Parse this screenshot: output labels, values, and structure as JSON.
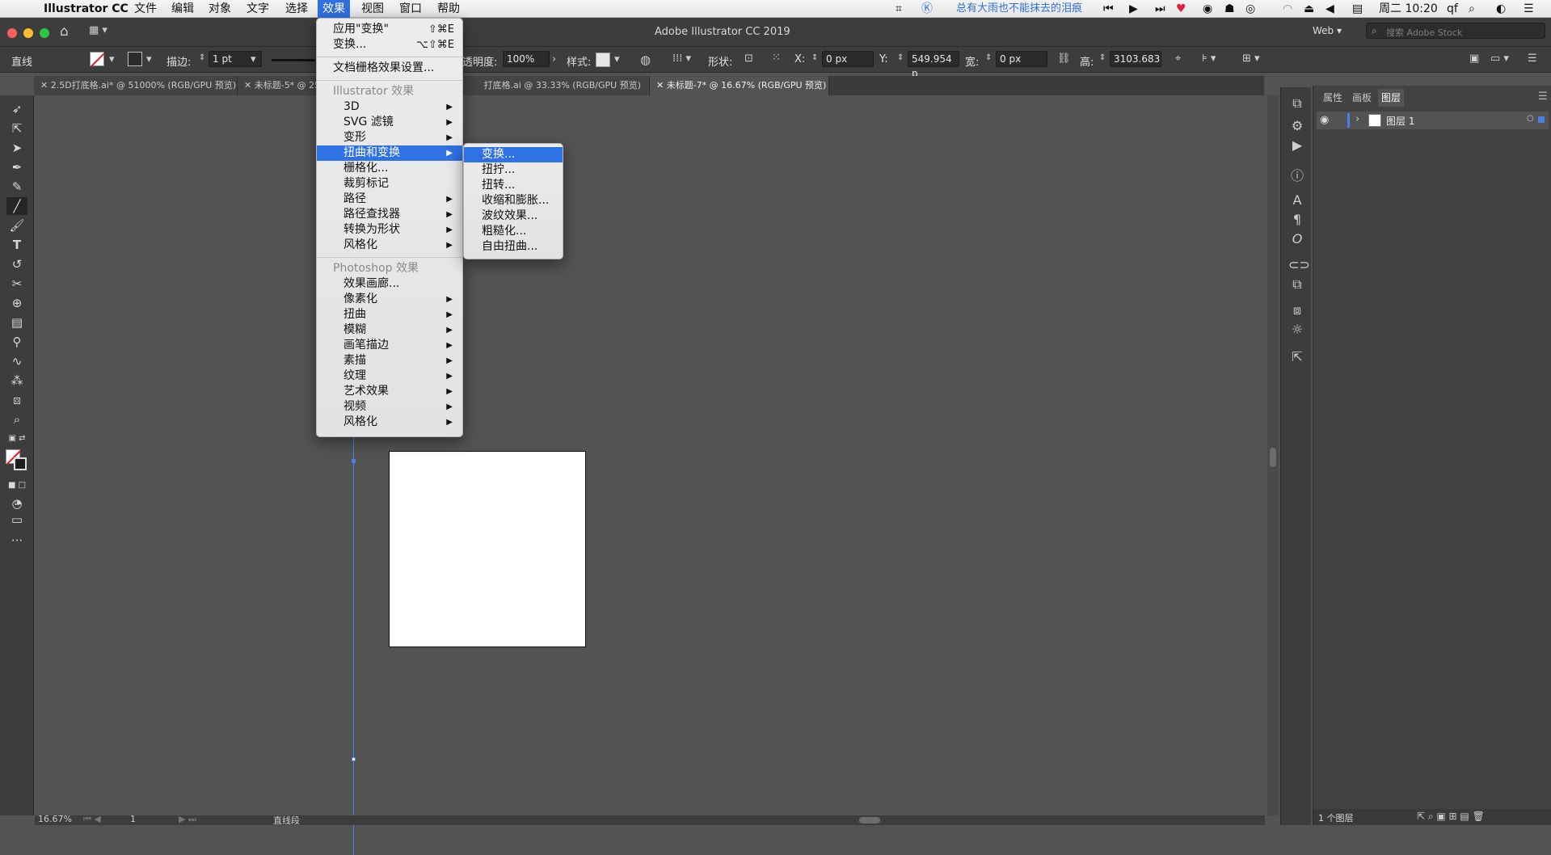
{
  "menubar": {
    "app_name": "Illustrator CC",
    "items": [
      "文件",
      "编辑",
      "对象",
      "文字",
      "选择",
      "效果",
      "视图",
      "窗口",
      "帮助"
    ],
    "active_item": "效果",
    "now_playing": "总有大雨也不能抹去的泪痕",
    "clock": "周二 10:20",
    "user": "qf"
  },
  "titlebar": {
    "title": "Adobe Illustrator CC 2019",
    "workspace": "Web",
    "stock_search_placeholder": "搜索 Adobe Stock"
  },
  "control": {
    "tool_name": "直线",
    "stroke_label": "描边:",
    "stroke_value": "1 pt",
    "opacity_label": "透明度:",
    "opacity_value": "100%",
    "style_label": "样式:",
    "shape_label": "形状:",
    "x_label": "X:",
    "x_value": "0 px",
    "y_label": "Y:",
    "y_value": "549.954 p",
    "w_label": "宽:",
    "w_value": "0 px",
    "h_label": "高:",
    "h_value": "3103.683"
  },
  "tabs": [
    {
      "label": "2.5D打底格.ai* @ 51000% (RGB/GPU 预览)"
    },
    {
      "label": "未标题-5* @ 25"
    },
    {
      "label": "打底格.ai @ 33.33% (RGB/GPU 预览)"
    },
    {
      "label": "未标题-7* @ 16.67% (RGB/GPU 预览)"
    }
  ],
  "effect_menu": {
    "apply_last": "应用\"变换\"",
    "apply_last_shortcut": "⇧⌘E",
    "last_effect": "变换...",
    "last_effect_shortcut": "⌥⇧⌘E",
    "raster_settings": "文档栅格效果设置...",
    "illustrator_header": "Illustrator 效果",
    "illustrator_items": [
      "3D",
      "SVG 滤镜",
      "变形",
      "扭曲和变换",
      "栅格化...",
      "裁剪标记",
      "路径",
      "路径查找器",
      "转换为形状",
      "风格化"
    ],
    "photoshop_header": "Photoshop 效果",
    "photoshop_items": [
      "效果画廊...",
      "像素化",
      "扭曲",
      "模糊",
      "画笔描边",
      "素描",
      "纹理",
      "艺术效果",
      "视频",
      "风格化"
    ]
  },
  "distort_submenu": {
    "items": [
      "变换...",
      "扭拧...",
      "扭转...",
      "收缩和膨胀...",
      "波纹效果...",
      "粗糙化...",
      "自由扭曲..."
    ]
  },
  "status": {
    "zoom": "16.67%",
    "artboard_num": "1",
    "selection": "直线段"
  },
  "panel": {
    "tabs": [
      "属性",
      "画板",
      "图层"
    ],
    "active_tab": "图层",
    "layer_name": "图层 1",
    "footer": "1 个图层"
  }
}
